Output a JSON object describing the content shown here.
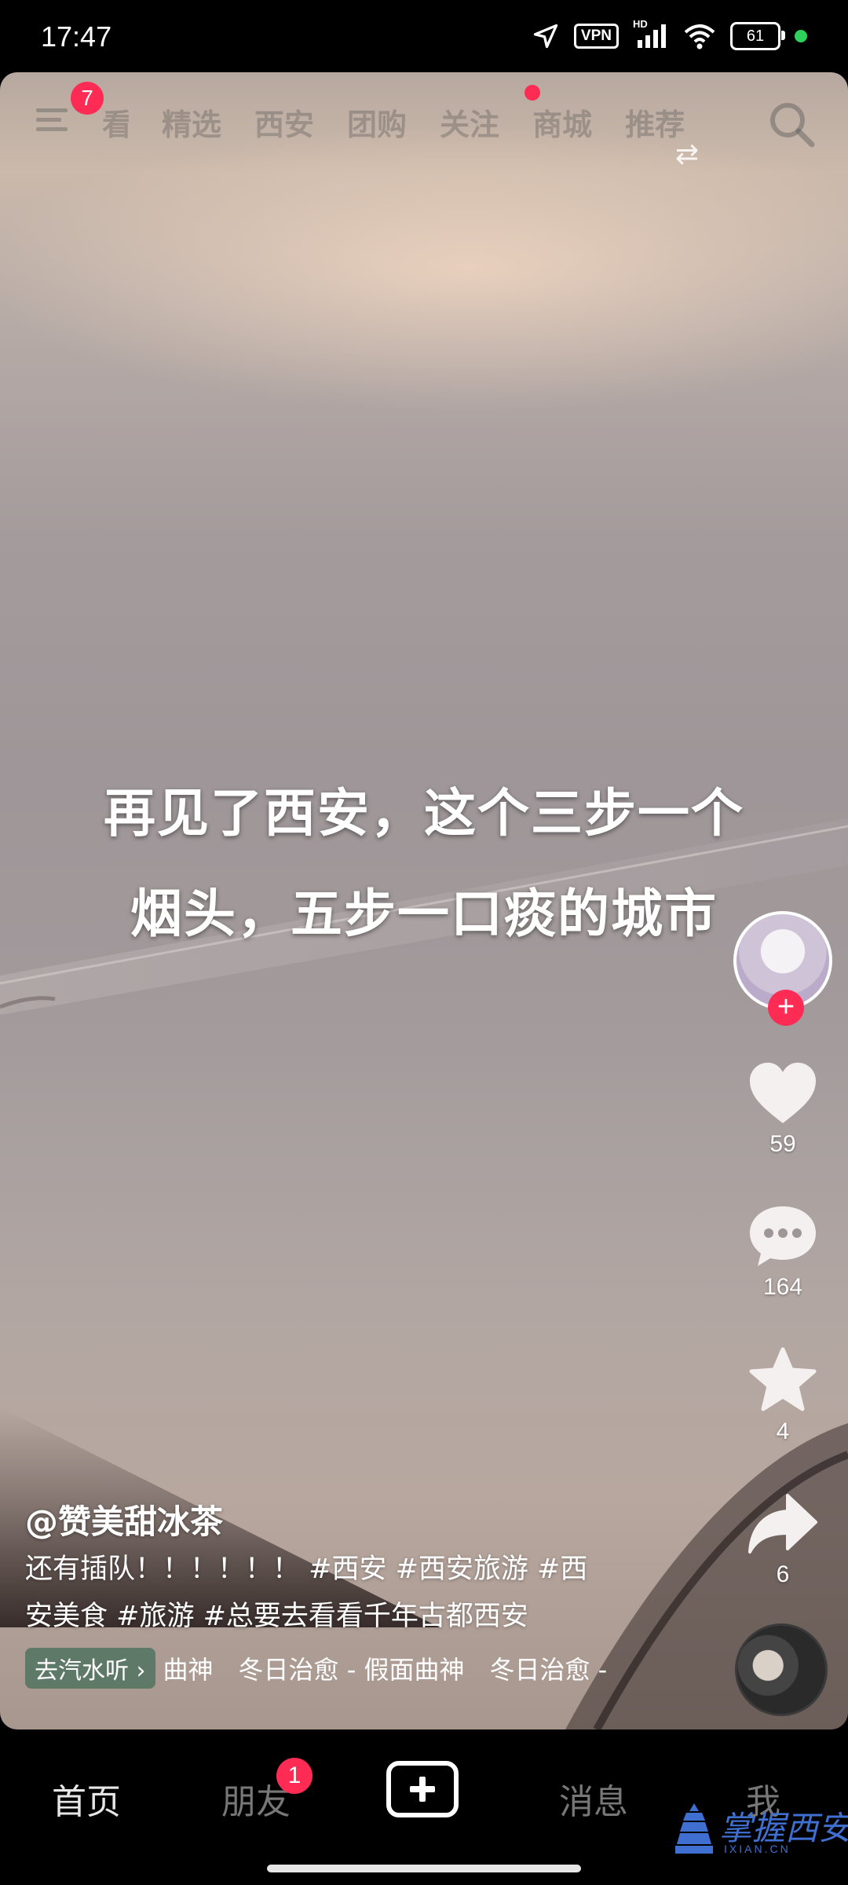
{
  "status_bar": {
    "time": "17:47",
    "vpn": "VPN",
    "hd": "HD",
    "battery": "61"
  },
  "top_nav": {
    "menu_badge": "7",
    "tabs": [
      "精选",
      "西安",
      "团购",
      "关注",
      "商城",
      "推荐"
    ],
    "partial_tab": "看"
  },
  "video": {
    "caption_line1": "再见了西安，这个三步一个",
    "caption_line2": "烟头，五步一口痰的城市"
  },
  "side_actions": {
    "likes": "59",
    "comments": "164",
    "favorites": "4",
    "shares": "6"
  },
  "post": {
    "author": "@赞美甜冰茶",
    "desc_line1": "还有插队！！！！！！ #西安 #西安旅游 #西",
    "desc_line2": "安美食 #旅游 #总要去看看千年古都西安",
    "music_tag": "去汽水听",
    "music_text": "曲神　冬日治愈 - 假面曲神　冬日治愈 -"
  },
  "tab_bar": {
    "home": "首页",
    "friends": "朋友",
    "friends_badge": "1",
    "messages": "消息",
    "me": "我"
  },
  "watermark": {
    "text": "掌握西安",
    "url": "IXIAN.CN"
  },
  "colors": {
    "accent_red": "#fe2c55",
    "music_tag_bg": "#466e5a"
  }
}
